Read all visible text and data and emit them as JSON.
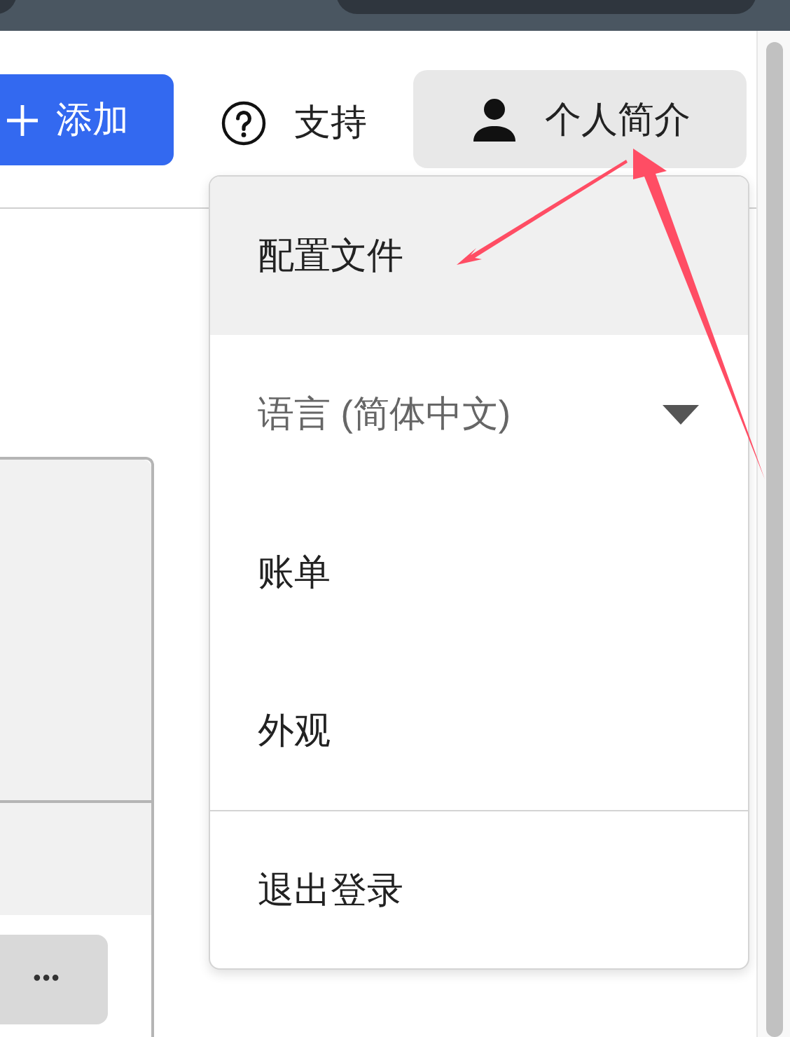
{
  "header": {
    "add_button": "添加",
    "support_link": "支持",
    "profile_button": "个人简介"
  },
  "card": {
    "more_button": "•••"
  },
  "profile_menu": {
    "items": [
      {
        "label": "配置文件",
        "kind": "link",
        "selected": true,
        "divider_before": false
      },
      {
        "label": "语言 (简体中文)",
        "kind": "submenu",
        "selected": false,
        "divider_before": false
      },
      {
        "label": "账单",
        "kind": "link",
        "selected": false,
        "divider_before": false
      },
      {
        "label": "外观",
        "kind": "link",
        "selected": false,
        "divider_before": false
      },
      {
        "label": "退出登录",
        "kind": "link",
        "selected": false,
        "divider_before": true
      }
    ]
  }
}
